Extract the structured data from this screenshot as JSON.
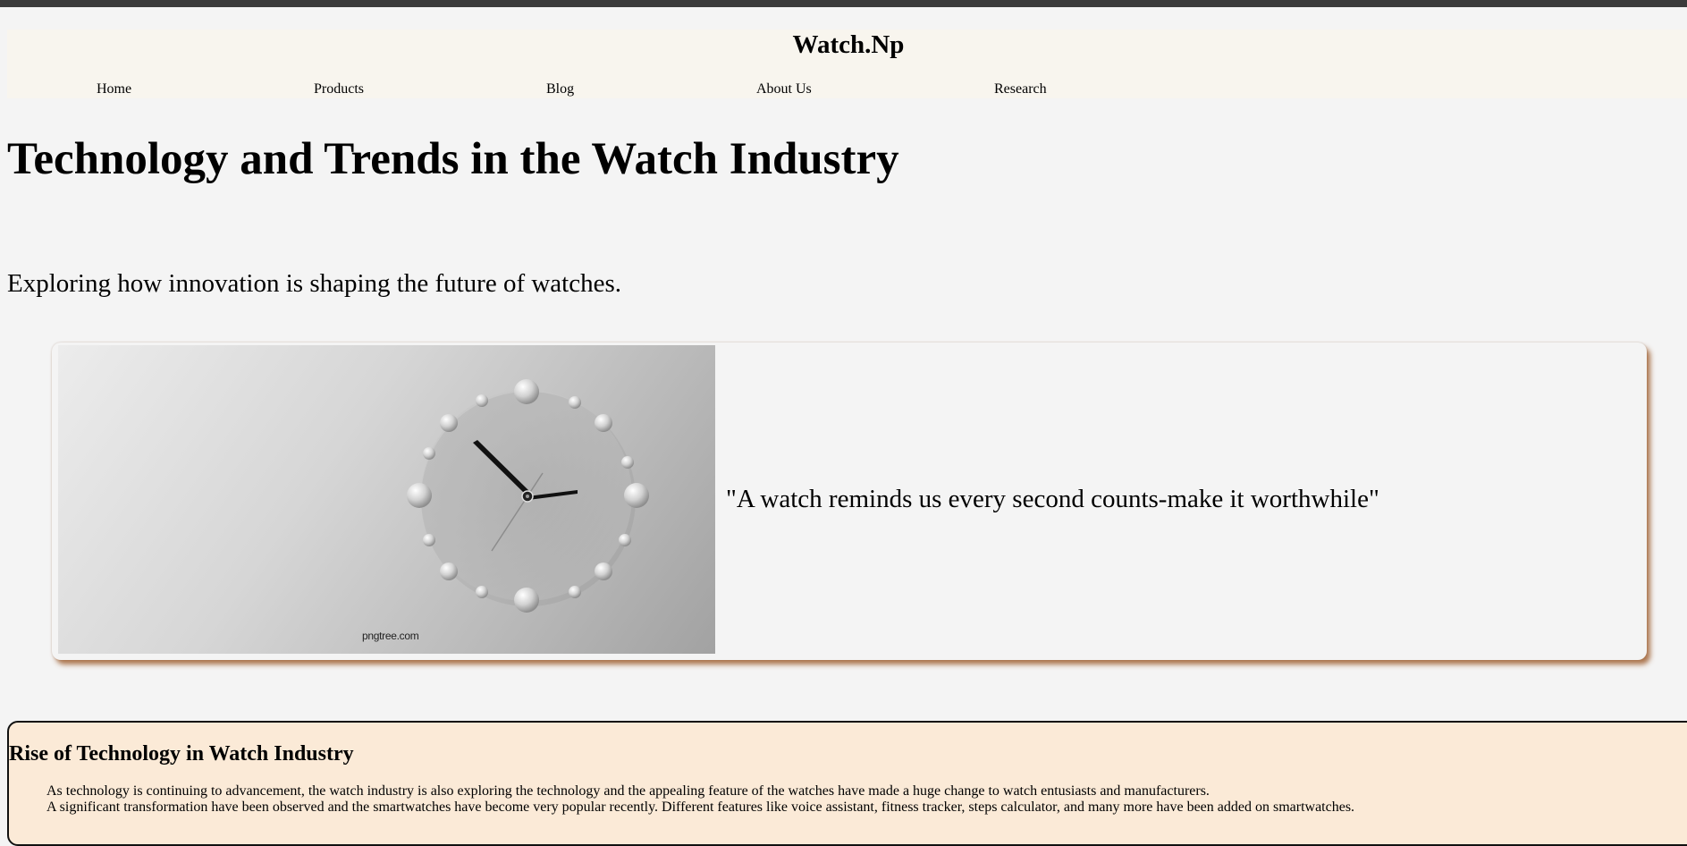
{
  "site": {
    "brand": "Watch.Np",
    "nav": [
      {
        "label": "Home"
      },
      {
        "label": "Products"
      },
      {
        "label": "Blog"
      },
      {
        "label": "About Us"
      },
      {
        "label": "Research"
      }
    ]
  },
  "page": {
    "title": "Technology and Trends in the Watch Industry",
    "subtitle": "Exploring how innovation is shaping the future of watches."
  },
  "hero": {
    "image_icon": "wall-clock-image",
    "watermark": "pngtree.com",
    "quote": "\"A watch reminds us every second counts-make it worthwhile\""
  },
  "article": {
    "heading": "Rise of Technology in Watch Industry",
    "paragraphs": [
      "As technology is continuing to advancement, the watch industry is also exploring the technology and the appealing feature of the watches have made a huge change to watch entusiasts and manufacturers.",
      "A significant transformation have been observed and the smartwatches have become very popular recently. Different features like voice assistant, fitness tracker, steps calculator, and many more have been added on smartwatches."
    ]
  },
  "colors": {
    "header_bg": "#f8f5ee",
    "page_bg": "#f4f4f4",
    "card_shadow": "#a06032",
    "article_bg": "#fbead7"
  }
}
